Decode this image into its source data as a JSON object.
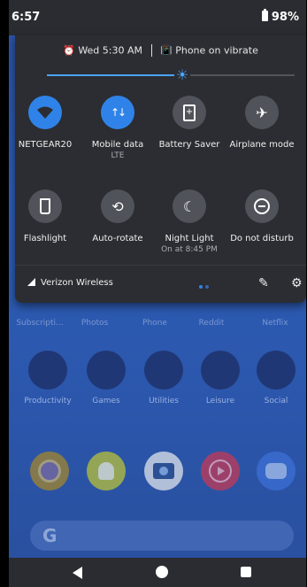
{
  "status_bar": {
    "time": "6:57",
    "battery": "98%"
  },
  "quick_settings": {
    "header": {
      "alarm": "Wed 5:30 AM",
      "ringer": "Phone on vibrate"
    },
    "brightness_percent": 55,
    "tiles": [
      {
        "label": "NETGEAR20",
        "sub": "",
        "icon": "wifi-icon",
        "active": true
      },
      {
        "label": "Mobile data",
        "sub": "LTE",
        "icon": "mobile-data-icon",
        "active": true
      },
      {
        "label": "Battery Saver",
        "sub": "",
        "icon": "battery-saver-icon",
        "active": false
      },
      {
        "label": "Airplane mode",
        "sub": "",
        "icon": "airplane-icon",
        "active": false
      },
      {
        "label": "Flashlight",
        "sub": "",
        "icon": "flashlight-icon",
        "active": false
      },
      {
        "label": "Auto-rotate",
        "sub": "",
        "icon": "rotate-icon",
        "active": false
      },
      {
        "label": "Night Light",
        "sub": "On at 8:45 PM",
        "icon": "moon-icon",
        "active": false
      },
      {
        "label": "Do not disturb",
        "sub": "",
        "icon": "dnd-icon",
        "active": false
      }
    ],
    "footer": {
      "carrier": "Verizon Wireless"
    }
  },
  "home": {
    "row1_labels": [
      "Subscripti...",
      "Photos",
      "Phone",
      "Reddit",
      "Netflix"
    ],
    "folders": [
      "Productivity",
      "Games",
      "Utilities",
      "Leisure",
      "Social"
    ],
    "search_letter": "G"
  },
  "colors": {
    "accent": "#2f83e8",
    "panel": "#2b2d32",
    "wallpaper": "#2e5db6"
  }
}
